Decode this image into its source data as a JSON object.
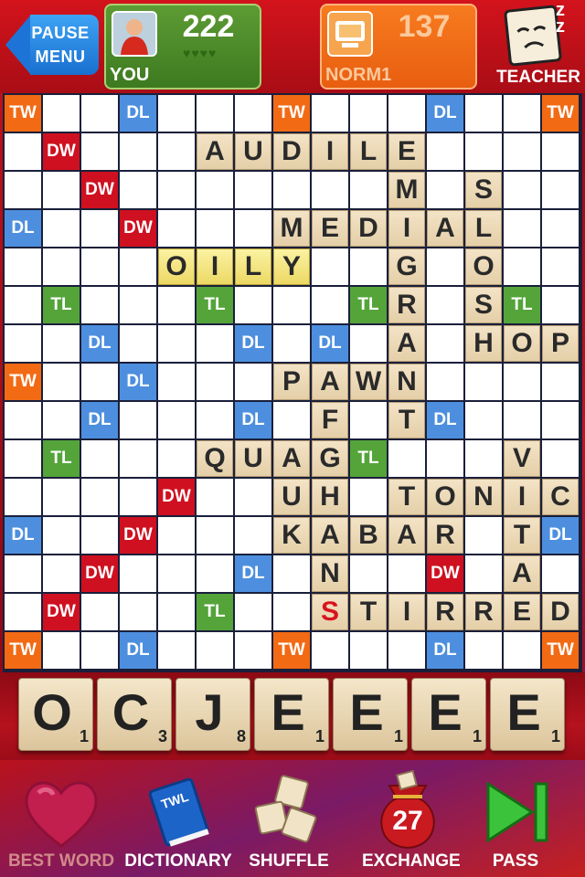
{
  "header": {
    "pause": {
      "line1": "PAUSE",
      "line2": "MENU"
    },
    "player": {
      "name": "YOU",
      "score": "222",
      "hearts": "♥♥♥♥"
    },
    "opponent": {
      "name": "NORM1",
      "score": "137"
    },
    "teacher": {
      "label": "TEACHER",
      "sleep": "z z"
    }
  },
  "board": {
    "size": 15,
    "premium_labels": {
      "TW": "TW",
      "DW": "DW",
      "DL": "DL",
      "TL": "TL"
    },
    "layout": [
      "T..L...T...L..T",
      ".D.............",
      "..D.............",
      "L..D...........",
      "...............",
      ".t...t...t...t.",
      "..L...L.L......",
      "T..L...........",
      "..L...L....L...",
      ".t.......t.....",
      "....D..........",
      "L..D..........L",
      "..D...L....D...",
      ".D...t.........",
      "T..L...T...L..T"
    ],
    "tiles": [
      {
        "row": 1,
        "col": 5,
        "letter": "A"
      },
      {
        "row": 1,
        "col": 6,
        "letter": "U"
      },
      {
        "row": 1,
        "col": 7,
        "letter": "D"
      },
      {
        "row": 1,
        "col": 8,
        "letter": "I"
      },
      {
        "row": 1,
        "col": 9,
        "letter": "L"
      },
      {
        "row": 1,
        "col": 10,
        "letter": "E"
      },
      {
        "row": 2,
        "col": 10,
        "letter": "M"
      },
      {
        "row": 2,
        "col": 12,
        "letter": "S"
      },
      {
        "row": 3,
        "col": 7,
        "letter": "M"
      },
      {
        "row": 3,
        "col": 8,
        "letter": "E"
      },
      {
        "row": 3,
        "col": 9,
        "letter": "D"
      },
      {
        "row": 3,
        "col": 10,
        "letter": "I"
      },
      {
        "row": 3,
        "col": 11,
        "letter": "A"
      },
      {
        "row": 3,
        "col": 12,
        "letter": "L"
      },
      {
        "row": 4,
        "col": 4,
        "letter": "O",
        "recent": true
      },
      {
        "row": 4,
        "col": 5,
        "letter": "I",
        "recent": true
      },
      {
        "row": 4,
        "col": 6,
        "letter": "L",
        "recent": true
      },
      {
        "row": 4,
        "col": 7,
        "letter": "Y",
        "recent": true
      },
      {
        "row": 4,
        "col": 10,
        "letter": "G"
      },
      {
        "row": 4,
        "col": 12,
        "letter": "O"
      },
      {
        "row": 5,
        "col": 10,
        "letter": "R"
      },
      {
        "row": 5,
        "col": 12,
        "letter": "S"
      },
      {
        "row": 6,
        "col": 10,
        "letter": "A"
      },
      {
        "row": 6,
        "col": 12,
        "letter": "H"
      },
      {
        "row": 6,
        "col": 13,
        "letter": "O"
      },
      {
        "row": 6,
        "col": 14,
        "letter": "P"
      },
      {
        "row": 7,
        "col": 7,
        "letter": "P"
      },
      {
        "row": 7,
        "col": 8,
        "letter": "A"
      },
      {
        "row": 7,
        "col": 9,
        "letter": "W"
      },
      {
        "row": 7,
        "col": 10,
        "letter": "N"
      },
      {
        "row": 8,
        "col": 8,
        "letter": "F"
      },
      {
        "row": 8,
        "col": 10,
        "letter": "T"
      },
      {
        "row": 9,
        "col": 5,
        "letter": "Q"
      },
      {
        "row": 9,
        "col": 6,
        "letter": "U"
      },
      {
        "row": 9,
        "col": 7,
        "letter": "A"
      },
      {
        "row": 9,
        "col": 8,
        "letter": "G"
      },
      {
        "row": 9,
        "col": 13,
        "letter": "V"
      },
      {
        "row": 10,
        "col": 7,
        "letter": "U"
      },
      {
        "row": 10,
        "col": 8,
        "letter": "H"
      },
      {
        "row": 10,
        "col": 10,
        "letter": "T"
      },
      {
        "row": 10,
        "col": 11,
        "letter": "O"
      },
      {
        "row": 10,
        "col": 12,
        "letter": "N"
      },
      {
        "row": 10,
        "col": 13,
        "letter": "I"
      },
      {
        "row": 10,
        "col": 14,
        "letter": "C"
      },
      {
        "row": 11,
        "col": 7,
        "letter": "K"
      },
      {
        "row": 11,
        "col": 8,
        "letter": "A"
      },
      {
        "row": 11,
        "col": 9,
        "letter": "B"
      },
      {
        "row": 11,
        "col": 10,
        "letter": "A"
      },
      {
        "row": 11,
        "col": 11,
        "letter": "R"
      },
      {
        "row": 11,
        "col": 13,
        "letter": "T"
      },
      {
        "row": 12,
        "col": 8,
        "letter": "N"
      },
      {
        "row": 12,
        "col": 13,
        "letter": "A"
      },
      {
        "row": 13,
        "col": 8,
        "letter": "S",
        "red": true
      },
      {
        "row": 13,
        "col": 9,
        "letter": "T"
      },
      {
        "row": 13,
        "col": 10,
        "letter": "I"
      },
      {
        "row": 13,
        "col": 11,
        "letter": "R"
      },
      {
        "row": 13,
        "col": 12,
        "letter": "R"
      },
      {
        "row": 13,
        "col": 13,
        "letter": "E"
      },
      {
        "row": 13,
        "col": 14,
        "letter": "D"
      }
    ]
  },
  "rack": [
    {
      "letter": "O",
      "points": "1"
    },
    {
      "letter": "C",
      "points": "3"
    },
    {
      "letter": "J",
      "points": "8"
    },
    {
      "letter": "E",
      "points": "1"
    },
    {
      "letter": "E",
      "points": "1"
    },
    {
      "letter": "E",
      "points": "1"
    },
    {
      "letter": "E",
      "points": "1"
    }
  ],
  "bottom_bar": {
    "best_word": "BEST WORD",
    "dictionary": "DICTIONARY",
    "dictionary_badge": "TWL",
    "shuffle": "SHUFFLE",
    "exchange": "EXCHANGE",
    "tiles_left": "27",
    "pass": "PASS"
  },
  "colors": {
    "TW": "#f26a14",
    "DW": "#cf1020",
    "DL": "#4d8fde",
    "TL": "#54a43a"
  }
}
